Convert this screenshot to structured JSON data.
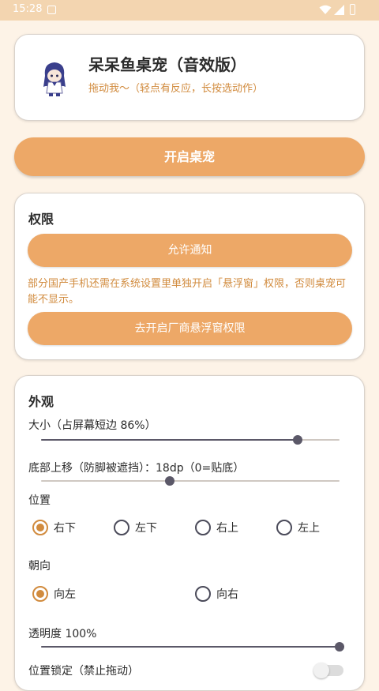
{
  "status_bar": {
    "time": "15:28"
  },
  "header": {
    "title": "呆呆鱼桌宠（音效版）",
    "subtitle": "拖动我～（轻点有反应，长按选动作）"
  },
  "primary_button": {
    "label": "开启桌宠"
  },
  "permissions": {
    "title": "权限",
    "notify_button": "允许通知",
    "note": "部分国产手机还需在系统设置里单独开启「悬浮窗」权限，否则桌宠可能不显示。",
    "overlay_button": "去开启厂商悬浮窗权限"
  },
  "appearance": {
    "title": "外观",
    "size_label": "大小（占屏幕短边 86%）",
    "size_value_percent": 86,
    "offset_label": "底部上移（防脚被遮挡）：18dp（0=贴底）",
    "offset_value_fraction": 0.43,
    "position_label": "位置",
    "position_options": [
      "右下",
      "左下",
      "右上",
      "左上"
    ],
    "position_selected": "右下",
    "direction_label": "朝向",
    "direction_options": [
      "向左",
      "向右"
    ],
    "direction_selected": "向左",
    "opacity_label": "透明度 100%",
    "opacity_value_percent": 100,
    "lock_label": "位置锁定（禁止拖动）",
    "lock_enabled": false
  },
  "colors": {
    "accent": "#eda867",
    "accent_text": "#d18b3e",
    "background": "#fdf3e7"
  }
}
